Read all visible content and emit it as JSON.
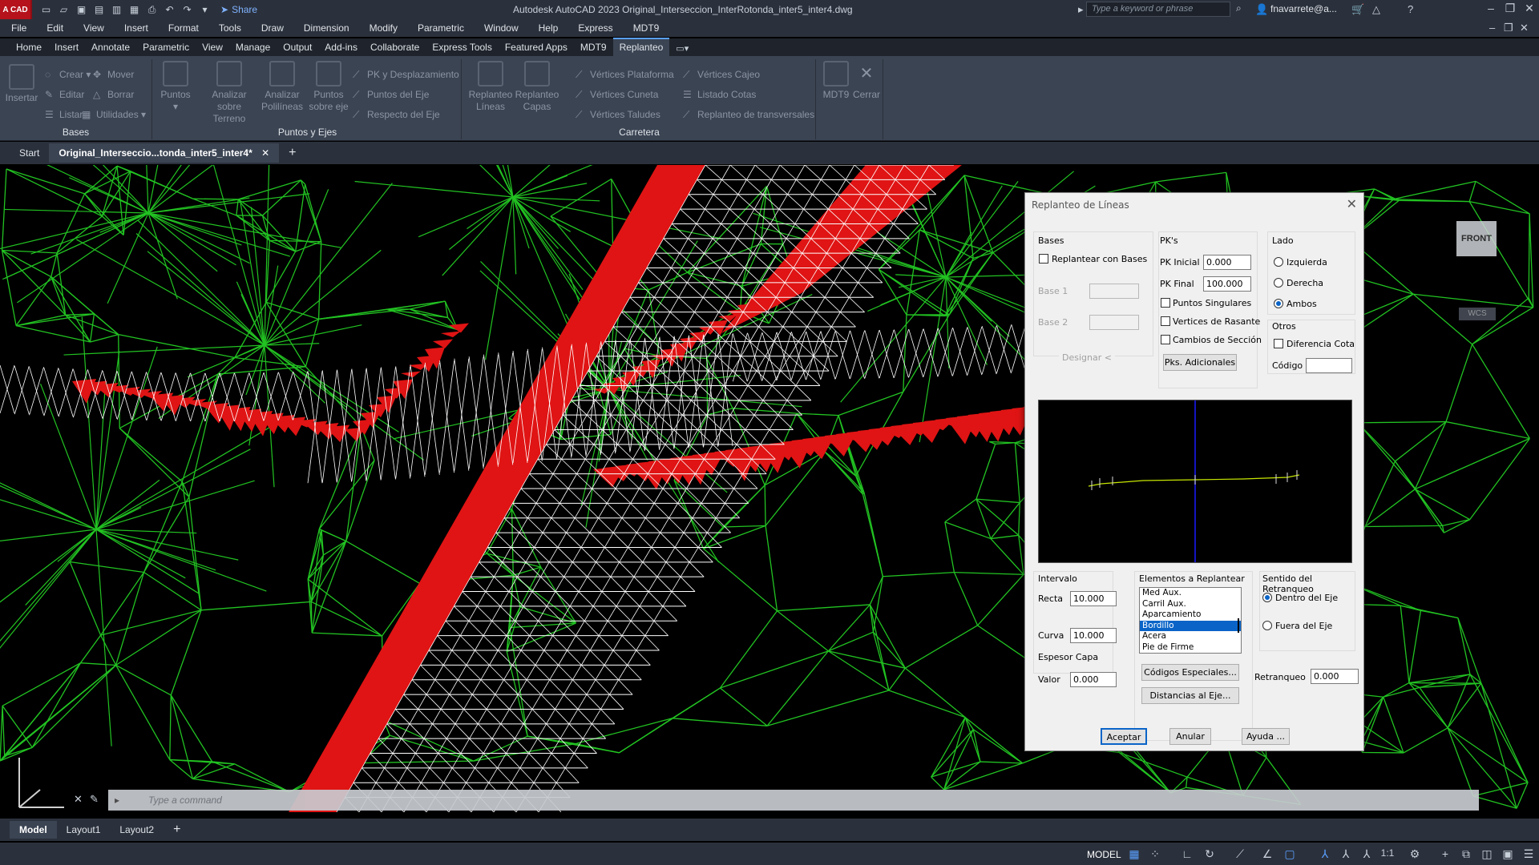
{
  "app": {
    "logo_text": "A CAD",
    "window_title": "Autodesk AutoCAD 2023    Original_Interseccion_InterRotonda_inter5_inter4.dwg",
    "share_label": "Share",
    "search_placeholder": "Type a keyword or phrase",
    "user_name": "fnavarrete@a..."
  },
  "menu": [
    "File",
    "Edit",
    "View",
    "Insert",
    "Format",
    "Tools",
    "Draw",
    "Dimension",
    "Modify",
    "Parametric",
    "Window",
    "Help",
    "Express",
    "MDT9"
  ],
  "ribbon_tabs": [
    {
      "label": "Home",
      "active": false
    },
    {
      "label": "Insert",
      "active": false
    },
    {
      "label": "Annotate",
      "active": false
    },
    {
      "label": "Parametric",
      "active": false
    },
    {
      "label": "View",
      "active": false
    },
    {
      "label": "Manage",
      "active": false
    },
    {
      "label": "Output",
      "active": false
    },
    {
      "label": "Add-ins",
      "active": false
    },
    {
      "label": "Collaborate",
      "active": false
    },
    {
      "label": "Express Tools",
      "active": false
    },
    {
      "label": "Featured Apps",
      "active": false
    },
    {
      "label": "MDT9",
      "active": false
    },
    {
      "label": "Replanteo",
      "active": true
    }
  ],
  "ribbon": {
    "bases": {
      "title": "Bases",
      "insertar": "Insertar",
      "crear": "Crear",
      "mover": "Mover",
      "editar": "Editar",
      "borrar": "Borrar",
      "listar": "Listar",
      "utilidades": "Utilidades"
    },
    "puntos_ejes": {
      "title": "Puntos y Ejes",
      "puntos": "Puntos",
      "analizar_terreno": "Analizar sobre Terreno",
      "analizar_polilineas": "Analizar Polilíneas",
      "puntos_sobre_eje": "Puntos sobre eje",
      "pk_desplazamiento": "PK y Desplazamiento",
      "puntos_del_eje": "Puntos del Eje",
      "respecto_eje": "Respecto del Eje"
    },
    "carretera": {
      "title": "Carretera",
      "replanteo_lineas": "Replanteo Líneas",
      "replanteo_capas": "Replanteo Capas",
      "vertices_plataforma": "Vértices Plataforma",
      "vertices_cuneta": "Vértices Cuneta",
      "vertices_taludes": "Vértices Taludes",
      "vertices_cajeo": "Vértices Cajeo",
      "listado_cotas": "Listado Cotas",
      "replanteo_transversales": "Replanteo de transversales"
    },
    "mdt9": "MDT9",
    "cerrar": "Cerrar"
  },
  "doc_tabs": [
    {
      "label": "Start",
      "active": false
    },
    {
      "label": "Original_Interseccio...tonda_inter5_inter4*",
      "active": true
    }
  ],
  "viewcube": {
    "face": "FRONT",
    "wcs": "WCS"
  },
  "command_line": {
    "placeholder": "Type a command"
  },
  "layout_tabs": [
    {
      "label": "Model",
      "active": true
    },
    {
      "label": "Layout1",
      "active": false
    },
    {
      "label": "Layout2",
      "active": false
    }
  ],
  "status": {
    "model": "MODEL",
    "scale": "1:1"
  },
  "dialog": {
    "title": "Replanteo de Líneas",
    "bases": {
      "group": "Bases",
      "replantear_con_bases": "Replantear con Bases",
      "base1": "Base 1",
      "base2": "Base 2",
      "designar": "Designar <"
    },
    "pks": {
      "group": "PK's",
      "pk_inicial_label": "PK Inicial",
      "pk_inicial": "0.000",
      "pk_final_label": "PK Final",
      "pk_final": "100.000",
      "puntos_singulares": "Puntos Singulares",
      "vertices_rasante": "Vertices de Rasante",
      "cambios_seccion": "Cambios de Sección",
      "pks_adicionales": "Pks. Adicionales"
    },
    "lado": {
      "group": "Lado",
      "izquierda": "Izquierda",
      "derecha": "Derecha",
      "ambos": "Ambos",
      "selected": "Ambos"
    },
    "otros": {
      "group": "Otros",
      "diferencia_cota": "Diferencia Cota",
      "codigo_label": "Código",
      "codigo": ""
    },
    "intervalo": {
      "group": "Intervalo",
      "recta_label": "Recta",
      "recta": "10.000",
      "curva_label": "Curva",
      "curva": "10.000"
    },
    "espesor": {
      "group": "Espesor Capa",
      "valor_label": "Valor",
      "valor": "0.000"
    },
    "elementos": {
      "group": "Elementos a Replantear",
      "items": [
        "Med Aux.",
        "Carril Aux.",
        "Aparcamiento",
        "Bordillo",
        "Acera",
        "Pie de Firme"
      ],
      "selected_index": 3,
      "codigos_especiales": "Códigos Especiales...",
      "distancias_eje": "Distancias al Eje..."
    },
    "sentido": {
      "group": "Sentido del Retranqueo",
      "dentro": "Dentro del Eje",
      "fuera": "Fuera del Eje",
      "selected": "Dentro del Eje",
      "retranqueo_label": "Retranqueo",
      "retranqueo": "0.000"
    },
    "buttons": {
      "aceptar": "Aceptar",
      "anular": "Anular",
      "ayuda": "Ayuda ..."
    }
  },
  "colors": {
    "terrain_mesh": "#22c322",
    "road_mesh": "#ffffff",
    "slope_mesh": "#e01414",
    "ribbon_bg": "#3b4453",
    "title_bg": "#2b313c",
    "preview_axis": "#1a1aff",
    "preview_profile": "#c8e600"
  }
}
